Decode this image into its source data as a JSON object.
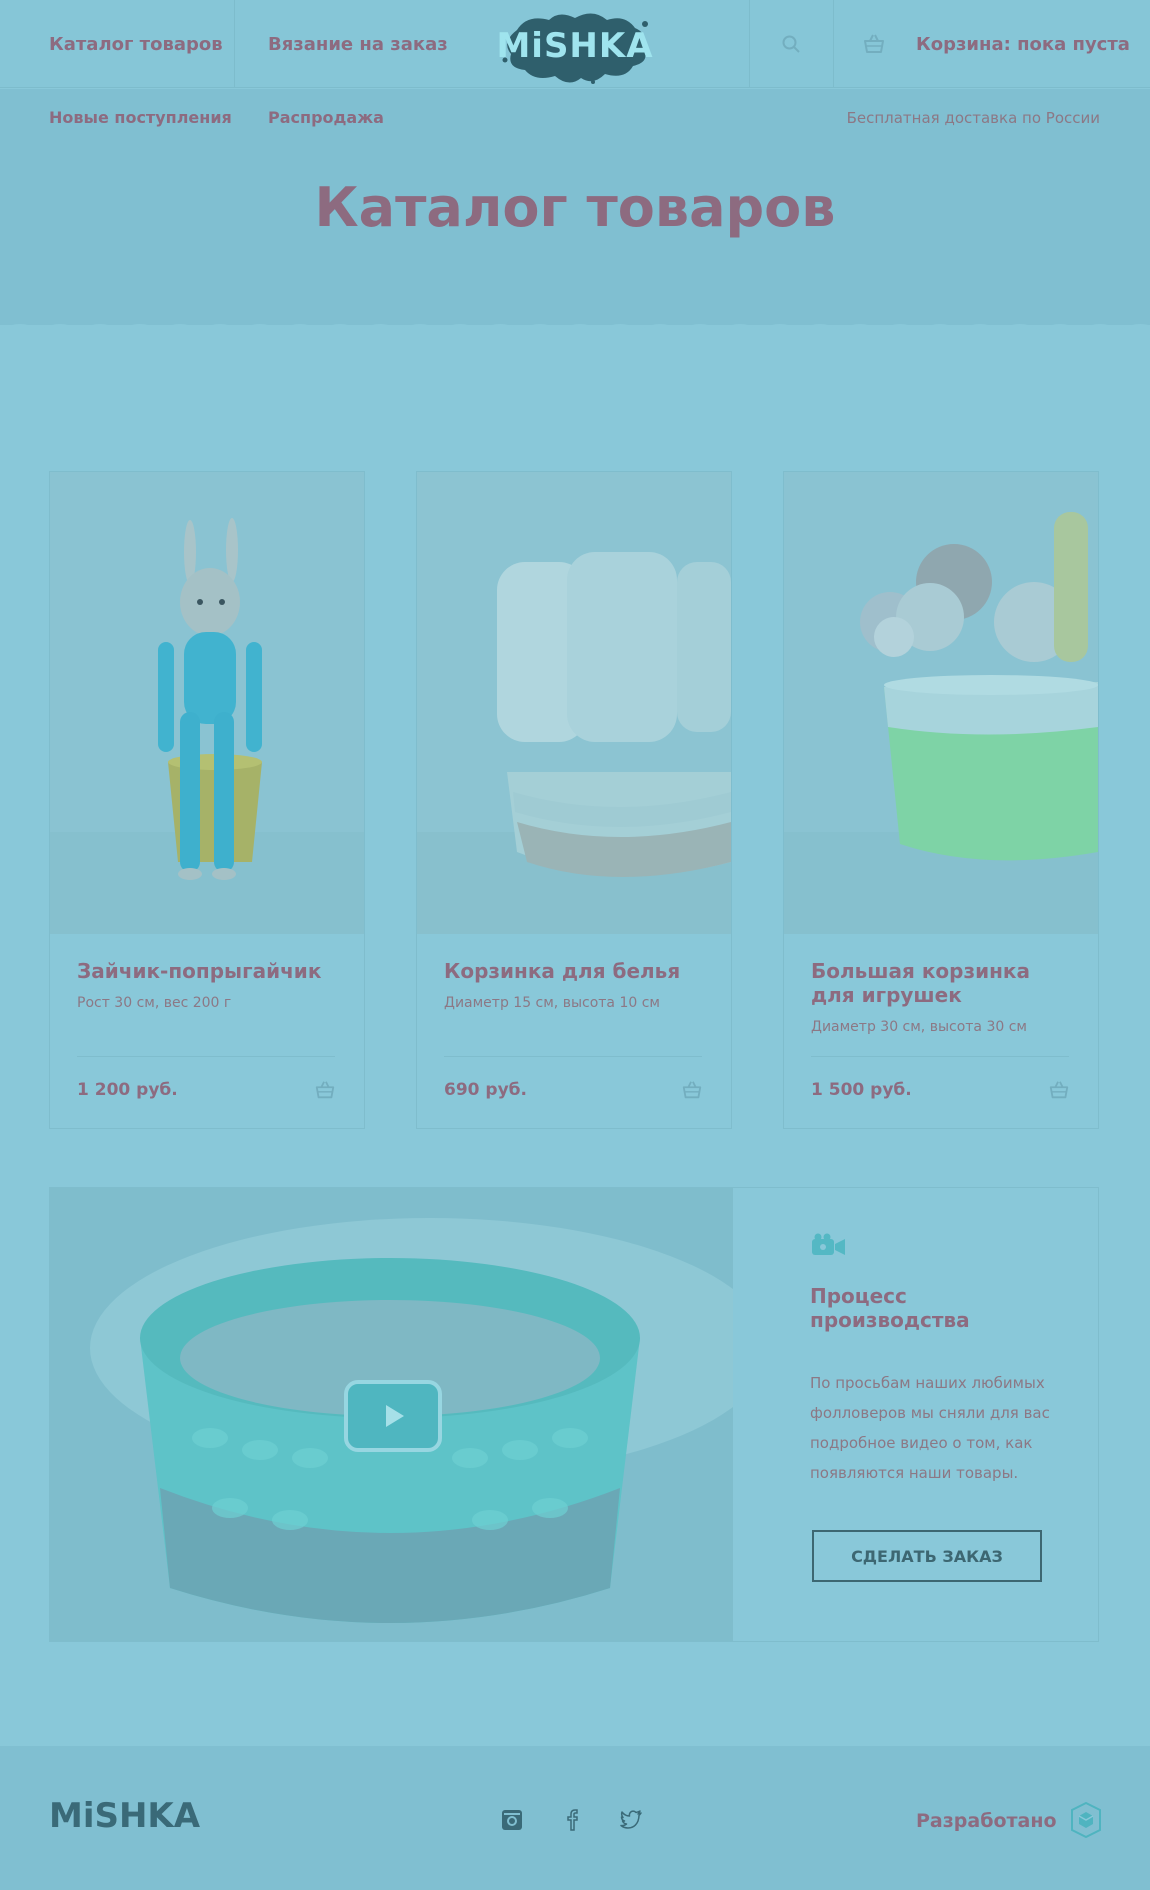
{
  "header": {
    "nav_catalog": "Каталог товаров",
    "nav_knitting": "Вязание на заказ",
    "logo_text": "MiSHKA",
    "cart_label": "Корзина: пока пуста",
    "search_icon": "search-icon",
    "cart_icon": "basket-icon"
  },
  "subnav": {
    "new_arrivals": "Новые поступления",
    "sale": "Распродажа",
    "delivery": "Бесплатная доставка по России"
  },
  "page_title": "Каталог товаров",
  "products": [
    {
      "name": "Зайчик-попрыгайчик",
      "desc": "Рост 30 см, вес 200 г",
      "price": "1 200 руб."
    },
    {
      "name": "Корзинка для белья",
      "desc": "Диаметр 15 см, высота 10 см",
      "price": "690 руб."
    },
    {
      "name": "Большая корзинка для игрушек",
      "desc": "Диаметр 30 см, высота 30 см",
      "price": "1 500 руб."
    }
  ],
  "video": {
    "title": "Процесс производства",
    "text": "По просьбам наших любимых фолловеров мы сняли для вас подробное видео о том, как появляются наши товары.",
    "order_button": "СДЕЛАТЬ ЗАКАЗ",
    "icon": "video-camera-icon"
  },
  "footer": {
    "logo_text": "MiSHKA",
    "developed_label": "Разработано",
    "social": [
      "instagram-icon",
      "facebook-icon",
      "twitter-icon"
    ]
  },
  "colors": {
    "background": "#89c8d9",
    "text_accent": "#8d6b80",
    "dark_teal": "#3d6772"
  }
}
